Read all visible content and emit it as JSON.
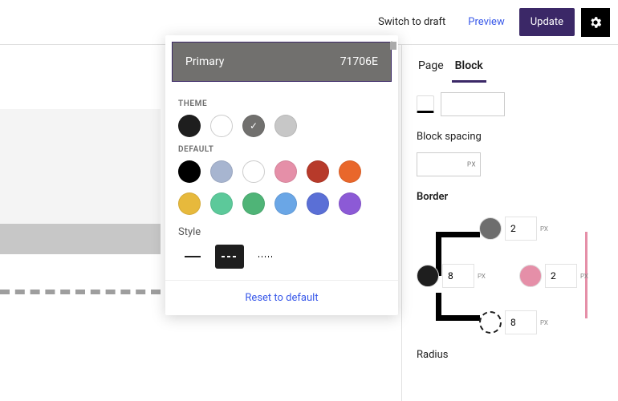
{
  "topbar": {
    "switch_draft": "Switch to draft",
    "preview": "Preview",
    "update": "Update"
  },
  "popover": {
    "selected_name": "Primary",
    "selected_hex": "71706E",
    "theme_label": "THEME",
    "theme_colors": [
      "#1e1e1e",
      "#ffffff",
      "#71706e",
      "#c7c7c7"
    ],
    "theme_selected_index": 2,
    "default_label": "DEFAULT",
    "default_colors": [
      "#000000",
      "#a7b5d0",
      "#ffffff",
      "#e58fa8",
      "#b73a2a",
      "#e9672b",
      "#e7b93c",
      "#5cc99a",
      "#4fb477",
      "#6aa6e6",
      "#5a6fd6",
      "#8c5ad6"
    ],
    "style_label": "Style",
    "reset": "Reset to default"
  },
  "sidebar": {
    "tabs": {
      "page": "Page",
      "block": "Block"
    },
    "block_spacing_label": "Block spacing",
    "block_spacing_value": "",
    "border_label": "Border",
    "border": {
      "top": {
        "color": "#6e6e6e",
        "value": "2",
        "unit": "PX"
      },
      "left": {
        "color": "#1e1e1e",
        "value": "8",
        "unit": "PX"
      },
      "right": {
        "color": "#e58fa8",
        "value": "2",
        "unit": "PX"
      },
      "bottom": {
        "color_style": "dashed",
        "value": "8",
        "unit": "PX"
      }
    },
    "radius_label": "Radius"
  }
}
